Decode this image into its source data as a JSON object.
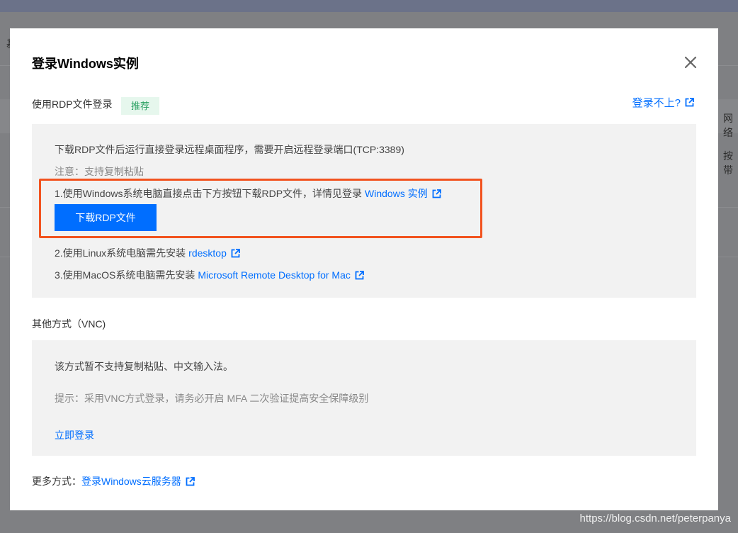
{
  "background": {
    "frag_left": "基",
    "frag_right_1": "网络",
    "frag_right_2": "按带"
  },
  "modal": {
    "title": "登录Windows实例",
    "close_label": "×",
    "rdp_section": {
      "label": "使用RDP文件登录",
      "badge": "推荐",
      "trouble_link": "登录不上?",
      "description": "下载RDP文件后运行直接登录远程桌面程序，需要开启远程登录端口(TCP:3389)",
      "note": "注意：支持复制粘贴",
      "steps": [
        {
          "text": "1.使用Windows系统电脑直接点击下方按钮下载RDP文件，详情见登录",
          "link": "Windows 实例"
        },
        {
          "text": "2.使用Linux系统电脑需先安装",
          "link": "rdesktop"
        },
        {
          "text": "3.使用MacOS系统电脑需先安装",
          "link": "Microsoft Remote Desktop for Mac"
        }
      ],
      "download_button": "下载RDP文件"
    },
    "vnc_section": {
      "label": "其他方式（VNC)",
      "description": "该方式暂不支持复制粘贴、中文输入法。",
      "hint": "提示：采用VNC方式登录，请务必开启 MFA 二次验证提高安全保障级别",
      "login_link": "立即登录"
    },
    "more": {
      "label": "更多方式：",
      "link": "登录Windows云服务器"
    }
  },
  "watermark": "https://blog.csdn.net/peterpanya",
  "colors": {
    "accent": "#006eff",
    "badge_bg": "#e6f7ed",
    "badge_text": "#29a061",
    "highlight": "#f2531f",
    "panel_bg": "#f2f2f2"
  }
}
